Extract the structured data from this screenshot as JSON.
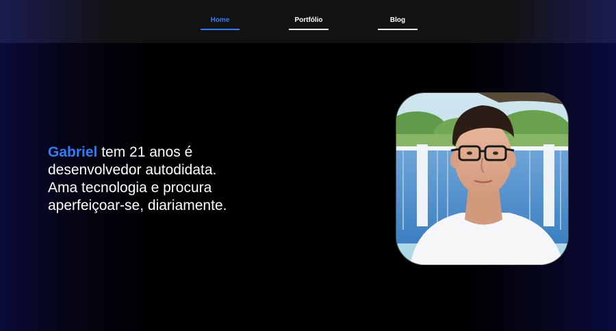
{
  "nav": {
    "items": [
      {
        "label": "Home",
        "active": true
      },
      {
        "label": "Portfólio",
        "active": false
      },
      {
        "label": "Blog",
        "active": false
      }
    ]
  },
  "intro": {
    "name": "Gabriel",
    "line1_rest": " tem 21 anos é",
    "line2": "desenvolvedor autodidata.",
    "line3": "Ama tecnologia e procura",
    "line4": "aperfeiçoar-se, diariamente."
  },
  "colors": {
    "accent": "#2d7ff9",
    "background": "#000000",
    "nav_background": "#121212"
  },
  "icons": {
    "profile_photo": "profile-photo"
  }
}
